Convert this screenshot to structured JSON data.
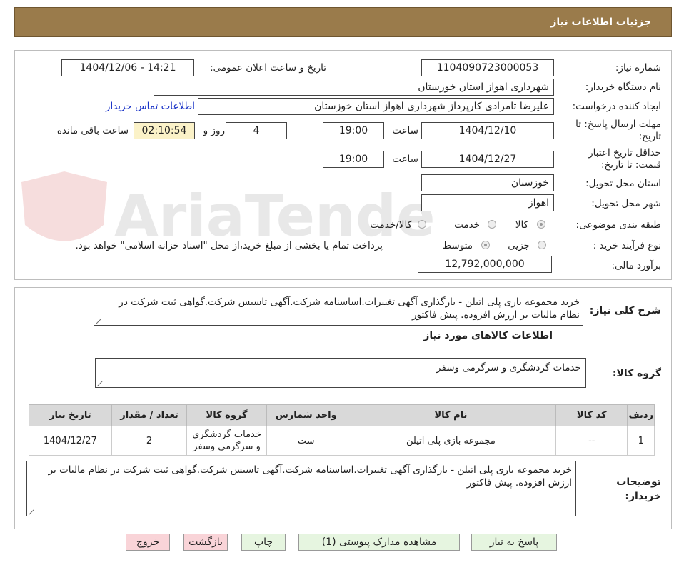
{
  "header": {
    "title": "جزئیات اطلاعات نیاز"
  },
  "watermark": {
    "text": "AriaTender.neT"
  },
  "form": {
    "need_number_label": "شماره نیاز:",
    "need_number": "1104090723000053",
    "announce_label": "تاریخ و ساعت اعلان عمومی:",
    "announce_value": "1404/12/06 - 14:21",
    "buyer_org_label": "نام دستگاه خریدار:",
    "buyer_org": "شهرداری اهواز استان خوزستان",
    "requester_label": "ایجاد کننده درخواست:",
    "requester": "علیرضا تامرادی کارپرداز شهرداری اهواز استان خوزستان",
    "contact_link": "اطلاعات تماس خریدار",
    "deadline_label": "مهلت ارسال پاسخ: تا تاریخ:",
    "deadline_date": "1404/12/10",
    "time_label": "ساعت",
    "deadline_time": "19:00",
    "days_value": "4",
    "days_label": "روز و",
    "remaining_time": "02:10:54",
    "remaining_label": "ساعت باقی مانده",
    "validity_label": "حداقل تاریخ اعتبار قیمت: تا تاریخ:",
    "validity_date": "1404/12/27",
    "validity_time": "19:00",
    "province_label": "استان محل تحویل:",
    "province": "خوزستان",
    "city_label": "شهر محل تحویل:",
    "city": "اهواز",
    "category_label": "طبقه بندی موضوعی:",
    "category_options": [
      "کالا",
      "خدمت",
      "کالا/خدمت"
    ],
    "process_label": "نوع فرآیند خرید :",
    "process_options": [
      "جزیی",
      "متوسط"
    ],
    "process_note": "پرداخت تمام یا بخشی از مبلغ خرید،از محل \"اسناد خزانه اسلامی\" خواهد بود.",
    "budget_label": "برآورد مالی:",
    "budget": "12,792,000,000"
  },
  "summary": {
    "label": "شرح کلی نیاز:",
    "text": "خرید مجموعه بازی پلی اتیلن - بارگذاری آگهی تغییرات.اساسنامه شرکت.آگهی تاسیس شرکت.گواهی ثبت شرکت در نظام مالیات بر ارزش افزوده. پیش فاکتور",
    "goods_info_title": "اطلاعات کالاهای مورد نیاز",
    "goods_group_label": "گروه کالا:",
    "goods_group": "خدمات گردشگری و سرگرمی وسفر"
  },
  "table": {
    "headers": [
      "ردیف",
      "کد کالا",
      "نام کالا",
      "واحد شمارش",
      "گروه کالا",
      "تعداد / مقدار",
      "تاریخ نیاز"
    ],
    "rows": [
      [
        "1",
        "--",
        "مجموعه بازی پلی اتیلن",
        "ست",
        "خدمات گردشگری و سرگرمی وسفر",
        "2",
        "1404/12/27"
      ]
    ]
  },
  "buyer_notes": {
    "label": "توضیحات خریدار:",
    "text": "خرید مجموعه بازی پلی اتیلن - بارگذاری آگهی تغییرات.اساسنامه شرکت.آگهی تاسیس شرکت.گواهی ثبت شرکت در نظام مالیات بر ارزش افزوده. پیش فاکتور"
  },
  "buttons": {
    "reply": "پاسخ به نیاز",
    "attachments": "مشاهده مدارک پیوستی (1)",
    "print": "چاپ",
    "back": "بازگشت",
    "exit": "خروج"
  }
}
